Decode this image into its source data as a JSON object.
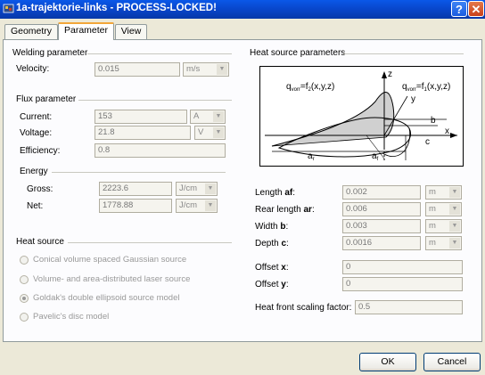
{
  "window": {
    "title": "1a-trajektorie-links - PROCESS-LOCKED!",
    "help_label": "?",
    "close_label": "✕"
  },
  "tabs": [
    {
      "label": "Geometry"
    },
    {
      "label": "Parameter"
    },
    {
      "label": "View"
    }
  ],
  "welding": {
    "header": "Welding parameter",
    "velocity_label": "Velocity:",
    "velocity_value": "0.015",
    "velocity_unit": "m/s"
  },
  "flux": {
    "header": "Flux parameter",
    "current_label": "Current:",
    "current_value": "153",
    "current_unit": "A",
    "voltage_label": "Voltage:",
    "voltage_value": "21.8",
    "voltage_unit": "V",
    "efficiency_label": "Efficiency:",
    "efficiency_value": "0.8"
  },
  "energy": {
    "header": "Energy",
    "gross_label": "Gross:",
    "gross_value": "2223.6",
    "gross_unit": "J/cm",
    "net_label": "Net:",
    "net_value": "1778.88",
    "net_unit": "J/cm"
  },
  "heat_source": {
    "header": "Heat source",
    "options": [
      {
        "label": "Conical volume spaced Gaussian source",
        "selected": false
      },
      {
        "label": "Volume- and area-distributed laser source",
        "selected": false
      },
      {
        "label": "Goldak's double ellipsoid source model",
        "selected": true
      },
      {
        "label": "Pavelic's disc model",
        "selected": false
      }
    ]
  },
  "heat_params": {
    "header": "Heat source parameters",
    "diagram": {
      "qvor": "q",
      "qvor_sub": "vorr",
      "qvor_rest": "=f",
      "qvor_fsub": "2",
      "qvor_args": "(x,y,z)",
      "qvorn_rest": "=f",
      "qvorn_fsub": "1",
      "qvorn_args": "(x,y,z)",
      "z": "z",
      "y": "y",
      "x": "x",
      "b": "b",
      "c": "c",
      "a": "a",
      "a_sub": "r",
      "af": "a",
      "af_sub": "f"
    },
    "length": {
      "prefix": "Length ",
      "bold": "af",
      "suffix": ":",
      "value": "0.002",
      "unit": "m"
    },
    "rear": {
      "prefix": "Rear length ",
      "bold": "ar",
      "suffix": ":",
      "value": "0.006",
      "unit": "m"
    },
    "width": {
      "prefix": "Width ",
      "bold": "b",
      "suffix": ":",
      "value": "0.003",
      "unit": "m"
    },
    "depth": {
      "prefix": "Depth ",
      "bold": "c",
      "suffix": ":",
      "value": "0.0016",
      "unit": "m"
    },
    "offset_x": {
      "prefix": "Offset ",
      "bold": "x",
      "suffix": ":",
      "value": "0"
    },
    "offset_y": {
      "prefix": "Offset ",
      "bold": "y",
      "suffix": ":",
      "value": "0"
    },
    "scaling": {
      "label": "Heat front scaling factor:",
      "value": "0.5"
    }
  },
  "buttons": {
    "ok": "OK",
    "cancel": "Cancel"
  },
  "colors": {
    "titlebar": "#0A58E8",
    "dialog_bg": "#ECE9D8",
    "panel_bg": "#FCFCFE"
  }
}
